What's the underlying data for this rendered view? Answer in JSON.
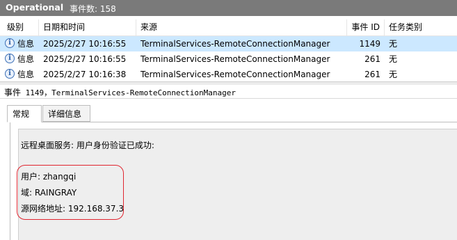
{
  "title_bar": {
    "log_name": "Operational",
    "event_count": "事件数: 158"
  },
  "table": {
    "headers": {
      "level": "级别",
      "datetime": "日期和时间",
      "source": "来源",
      "event_id": "事件 ID",
      "task": "任务类别"
    },
    "rows": [
      {
        "level": "信息",
        "datetime": "2025/2/27 10:16:55",
        "source": "TerminalServices-RemoteConnectionManager",
        "event_id": "1149",
        "task": "无",
        "selected": true
      },
      {
        "level": "信息",
        "datetime": "2025/2/27 10:16:55",
        "source": "TerminalServices-RemoteConnectionManager",
        "event_id": "261",
        "task": "无",
        "selected": false
      },
      {
        "level": "信息",
        "datetime": "2025/2/27 10:16:38",
        "source": "TerminalServices-RemoteConnectionManager",
        "event_id": "261",
        "task": "无",
        "selected": false
      }
    ],
    "icon": "info-icon"
  },
  "detail": {
    "title_prefix": "事件",
    "title_rest": " 1149，TerminalServices-RemoteConnectionManager",
    "tabs": [
      "常规",
      "详细信息"
    ],
    "active_tab": "常规",
    "message": {
      "line1": "远程桌面服务: 用户身份验证已成功:",
      "user": "用户: zhangqi",
      "domain": "域: RAINGRAY",
      "source_ip": "源网络地址: 192.168.37.3"
    },
    "highlight_color": "#e0252f"
  },
  "colors": {
    "title_bar": "#7a7a7a",
    "selected_row": "#cce8ff"
  }
}
